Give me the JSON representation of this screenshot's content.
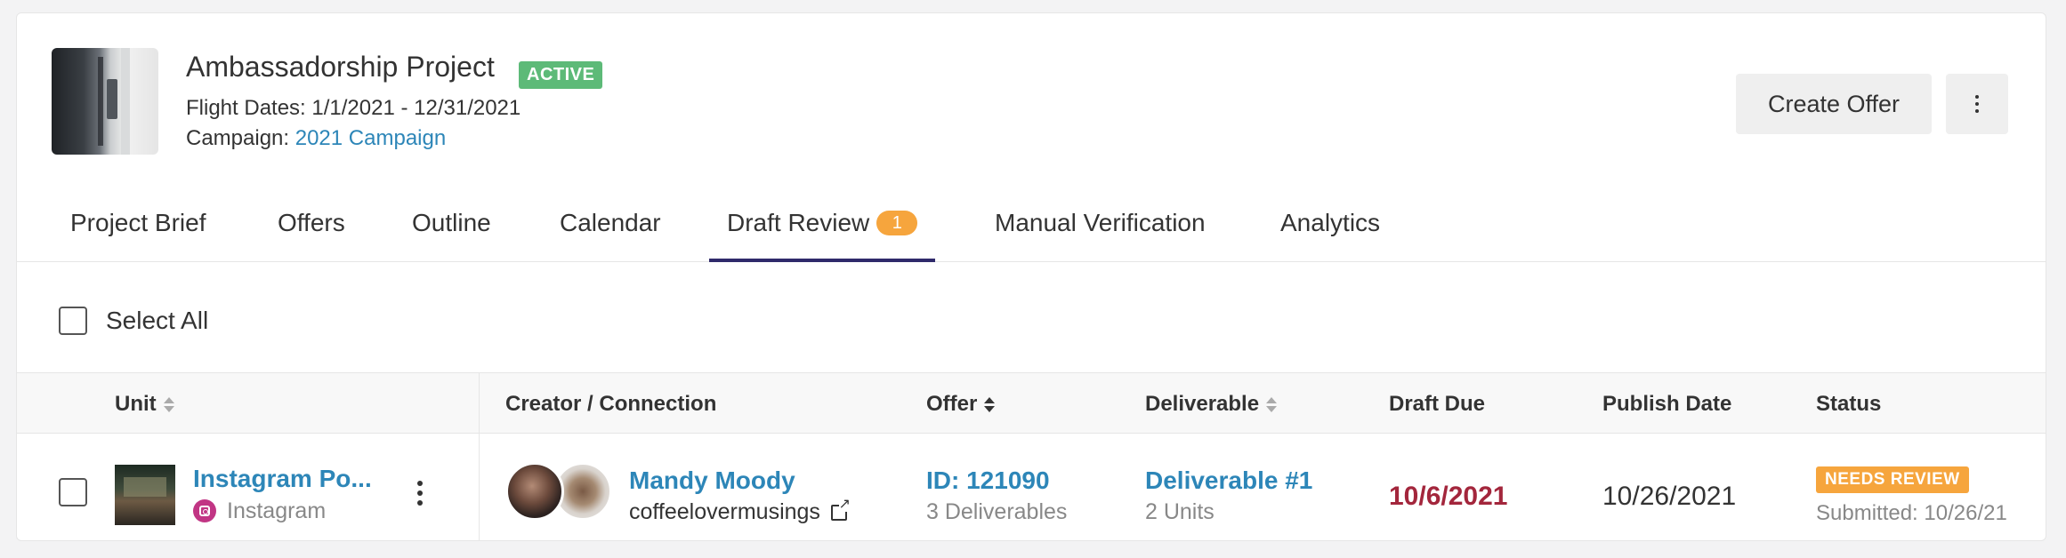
{
  "project": {
    "title": "Ambassadorship Project",
    "status": "ACTIVE",
    "flight_dates": "Flight Dates: 1/1/2021 - 12/31/2021",
    "campaign_label": "Campaign: ",
    "campaign_link": "2021 Campaign"
  },
  "actions": {
    "create_offer": "Create Offer",
    "more_icon": "vertical-dots-icon"
  },
  "tabs": [
    {
      "label": "Project Brief"
    },
    {
      "label": "Offers"
    },
    {
      "label": "Outline"
    },
    {
      "label": "Calendar"
    },
    {
      "label": "Draft Review",
      "badge": "1",
      "active": true
    },
    {
      "label": "Manual Verification"
    },
    {
      "label": "Analytics"
    }
  ],
  "select_all": {
    "label": "Select All"
  },
  "table": {
    "headers": {
      "unit": "Unit",
      "creator": "Creator / Connection",
      "offer": "Offer",
      "deliverable": "Deliverable",
      "draft_due": "Draft Due",
      "publish_date": "Publish Date",
      "status": "Status"
    },
    "rows": [
      {
        "unit_title": "Instagram Po...",
        "unit_platform": "Instagram",
        "creator_name": "Mandy Moody",
        "creator_handle": "coffeelovermusings",
        "offer_id": "ID: 121090",
        "offer_sub": "3 Deliverables",
        "deliverable": "Deliverable #1",
        "deliverable_sub": "2 Units",
        "draft_due": "10/6/2021",
        "publish_date": "10/26/2021",
        "status": "NEEDS REVIEW",
        "submitted": "Submitted: 10/26/21"
      }
    ]
  },
  "colors": {
    "accent_link": "#2d86b8",
    "active_badge": "#5dba78",
    "review_badge": "#f6a53d",
    "overdue": "#a3263c",
    "tab_underline": "#2f2a6b"
  }
}
